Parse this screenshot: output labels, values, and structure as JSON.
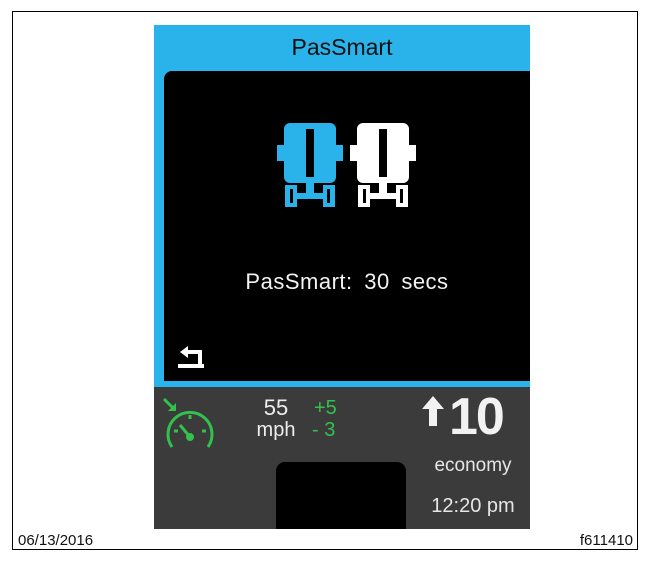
{
  "screen": {
    "title": "PasSmart",
    "message": "PasSmart: 30  secs"
  },
  "icons": {
    "truck_left": "truck-rear-icon",
    "truck_right": "truck-rear-icon",
    "back": "back-arrow-icon",
    "cruise": "speedometer-set-icon",
    "shift": "upshift-arrow-icon"
  },
  "status_bar": {
    "speed_value": "55",
    "speed_unit": "mph",
    "delta_up": "+5",
    "delta_down": "- 3",
    "gear": "10",
    "mode": "economy",
    "time": "12:20 pm"
  },
  "footer": {
    "date": "06/13/2016",
    "figure_id": "f611410"
  },
  "colors": {
    "accent": "#2ab3ea",
    "panel": "#000000",
    "status_bg": "#3b3b3b",
    "positive": "#33c14e",
    "text_light": "#f2f2f2"
  }
}
